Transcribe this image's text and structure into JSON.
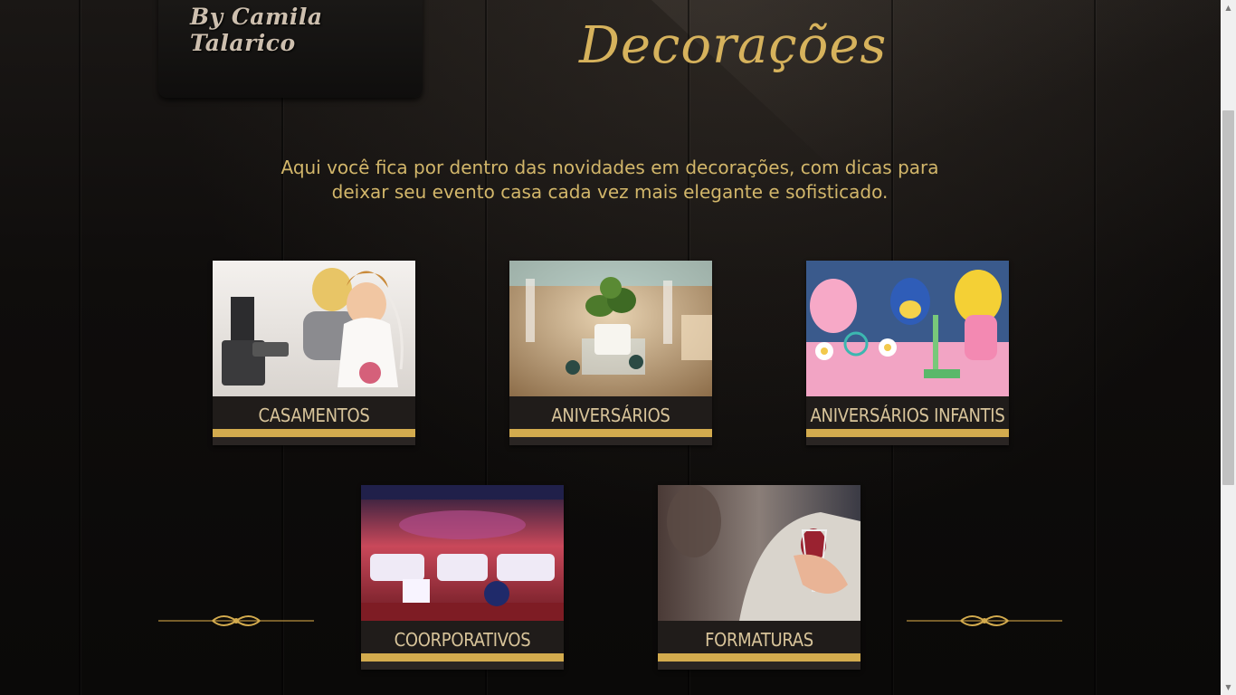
{
  "header": {
    "logo_text": "By Camila Talarico",
    "page_title": "Decorações"
  },
  "intro": {
    "line1": "Aqui você fica por dentro das novidades em decorações, com dicas para",
    "line2": "deixar seu evento casa cada vez mais elegante e sofisticado."
  },
  "categories": [
    {
      "label": "CASAMENTOS"
    },
    {
      "label": "ANIVERSÁRIOS"
    },
    {
      "label": "ANIVERSÁRIOS INFANTIS"
    },
    {
      "label": "COORPORATIVOS"
    },
    {
      "label": "FORMATURAS"
    }
  ],
  "colors": {
    "gold": "#d3ab4e",
    "title_gold": "#d6b25c",
    "text_gold": "#d2b66a",
    "background": "#0d0b0a"
  }
}
